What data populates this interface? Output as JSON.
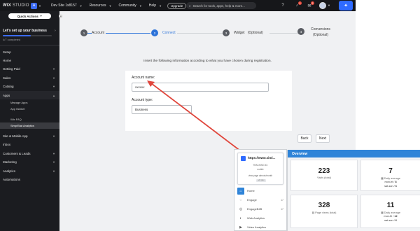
{
  "topbar": {
    "brand_wix": "WIX",
    "brand_studio": "STUDIO",
    "site_avatar_letter": "A",
    "site_name": "Dev Site 1s8157",
    "menu": [
      "Resources",
      "Community",
      "Help"
    ],
    "upgrade": "Upgrade",
    "search_placeholder": "Search for tools, apps, help & more...",
    "badges": {
      "notifications": "1",
      "messages": "2"
    },
    "icons": [
      "bell-icon",
      "chat-icon",
      "inbox-icon"
    ]
  },
  "sidebar": {
    "quick_actions": "Quick Actions",
    "setup_title": "Let's set up your business",
    "setup_progress": "4/7 completed",
    "setup_fraction": 0.57,
    "items": [
      {
        "label": "Setup",
        "chevron": false
      },
      {
        "label": "Home",
        "chevron": false
      },
      {
        "label": "Getting Paid",
        "chevron": true
      },
      {
        "label": "Sales",
        "chevron": true
      },
      {
        "label": "Catalog",
        "chevron": true
      },
      {
        "label": "Apps",
        "chevron": true
      }
    ],
    "apps_sub": [
      "Manage Apps",
      "App Market"
    ],
    "apps_sub2": [
      "Wix FAQ",
      "SimplStat Analytics"
    ],
    "items_after": [
      {
        "label": "Site & Mobile App",
        "chevron": true
      },
      {
        "label": "Inbox",
        "chevron": false
      },
      {
        "label": "Customers & Leads",
        "chevron": true
      },
      {
        "label": "Marketing",
        "chevron": true
      },
      {
        "label": "Analytics",
        "chevron": true
      },
      {
        "label": "Automations",
        "chevron": false
      }
    ]
  },
  "steps": [
    {
      "num": "1",
      "label": "Account"
    },
    {
      "num": "2",
      "label": "Connect"
    },
    {
      "num": "3",
      "label": "Widget   (Optional)"
    },
    {
      "num": "4",
      "label": "Conversions",
      "sub": "(Optional)"
    }
  ],
  "intro_text": "Insert the following information according to what you have chosen during registration.",
  "form": {
    "account_name_label": "Account name:",
    "account_name_value": "xxxxxx",
    "account_type_label": "Account type:",
    "account_type_value": "Business"
  },
  "buttons": {
    "back": "Back",
    "next": "Next"
  },
  "panel": {
    "url": "https://www.simi...",
    "sub1": "TRACKING ID:",
    "sub2": "mobile",
    "sub3": "view page almost/month",
    "chip": "edit plan",
    "nav": [
      {
        "label": "Home",
        "count": "",
        "icon": "home-icon"
      },
      {
        "label": "Engage",
        "count": "17",
        "icon": "engage-icon"
      },
      {
        "label": "EngageB2B",
        "count": "17",
        "icon": "engage-b2b-icon"
      },
      {
        "label": "Web Analytics",
        "count": "",
        "icon": "analytics-icon"
      },
      {
        "label": "Video Analytics",
        "count": "",
        "icon": "video-icon"
      }
    ]
  },
  "overview": {
    "title": "Overview",
    "visits": {
      "value": "223",
      "label": "Visits (total)"
    },
    "visits_daily": {
      "value": "7",
      "label": "Daily average",
      "line1_day": "mon-fri /",
      "line1_val": "8",
      "line2_day": "sat-sun /",
      "line2_val": "6"
    },
    "pageviews": {
      "value": "328",
      "label": "Page views (total)"
    },
    "pageviews_daily": {
      "value": "11",
      "label": "Daily average",
      "line1_day": "mon-fri /",
      "line1_val": "12",
      "line2_day": "sat-sun /",
      "line2_val": "6"
    }
  }
}
